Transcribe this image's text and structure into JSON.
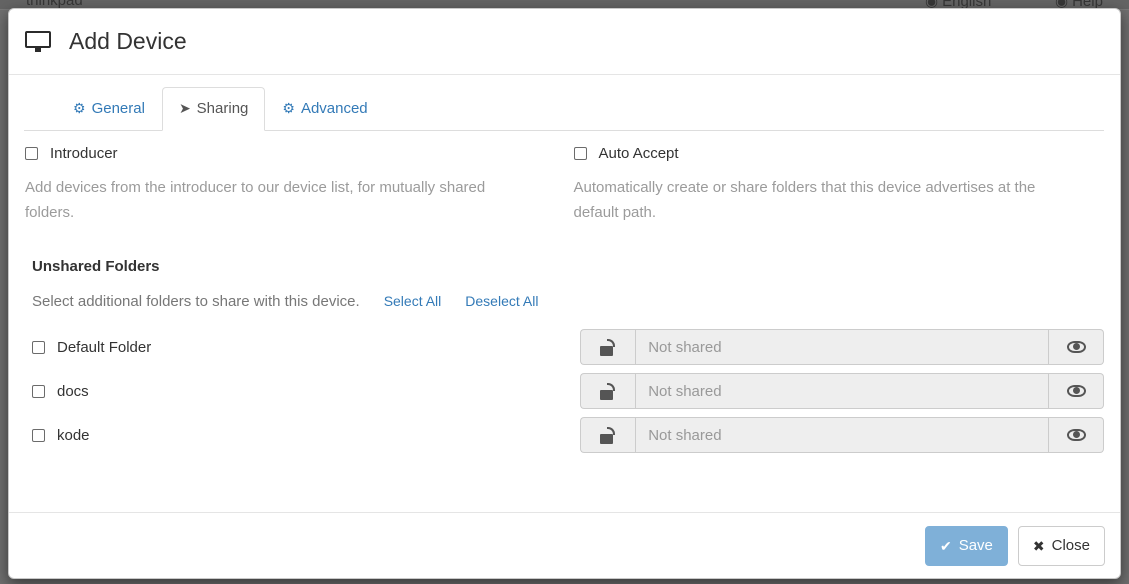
{
  "background": {
    "brand": "thinkpad",
    "language_label": "English",
    "help_label": "Help",
    "globe_icon": "globe-icon",
    "question_icon": "question-circle-icon"
  },
  "modal": {
    "title": "Add Device",
    "title_icon": "desktop-icon",
    "tabs": [
      {
        "label": "General",
        "icon": "gear-icon",
        "active": false
      },
      {
        "label": "Sharing",
        "icon": "share-alt-icon",
        "active": true
      },
      {
        "label": "Advanced",
        "icon": "cogs-icon",
        "active": false
      }
    ],
    "options": [
      {
        "label": "Introducer",
        "checked": false,
        "help": "Add devices from the introducer to our device list, for mutually shared folders."
      },
      {
        "label": "Auto Accept",
        "checked": false,
        "help": "Automatically create or share folders that this device advertises at the default path."
      }
    ],
    "unshared": {
      "heading": "Unshared Folders",
      "description": "Select additional folders to share with this device.",
      "select_all_label": "Select All",
      "deselect_all_label": "Deselect All",
      "folders": [
        {
          "name": "Default Folder",
          "checked": false,
          "lock_icon": "unlock-icon",
          "share_value": "",
          "share_placeholder": "Not shared",
          "eye_icon": "eye-icon"
        },
        {
          "name": "docs",
          "checked": false,
          "lock_icon": "unlock-icon",
          "share_value": "",
          "share_placeholder": "Not shared",
          "eye_icon": "eye-icon"
        },
        {
          "name": "kode",
          "checked": false,
          "lock_icon": "unlock-icon",
          "share_value": "",
          "share_placeholder": "Not shared",
          "eye_icon": "eye-icon"
        }
      ]
    },
    "footer": {
      "save_label": "Save",
      "save_icon": "check-icon",
      "close_label": "Close",
      "close_icon": "times-icon"
    }
  },
  "colors": {
    "link": "#337ab7",
    "primary_disabled": "#7fb0d8",
    "muted_text": "#999999",
    "backdrop": "#6f6f6f"
  }
}
